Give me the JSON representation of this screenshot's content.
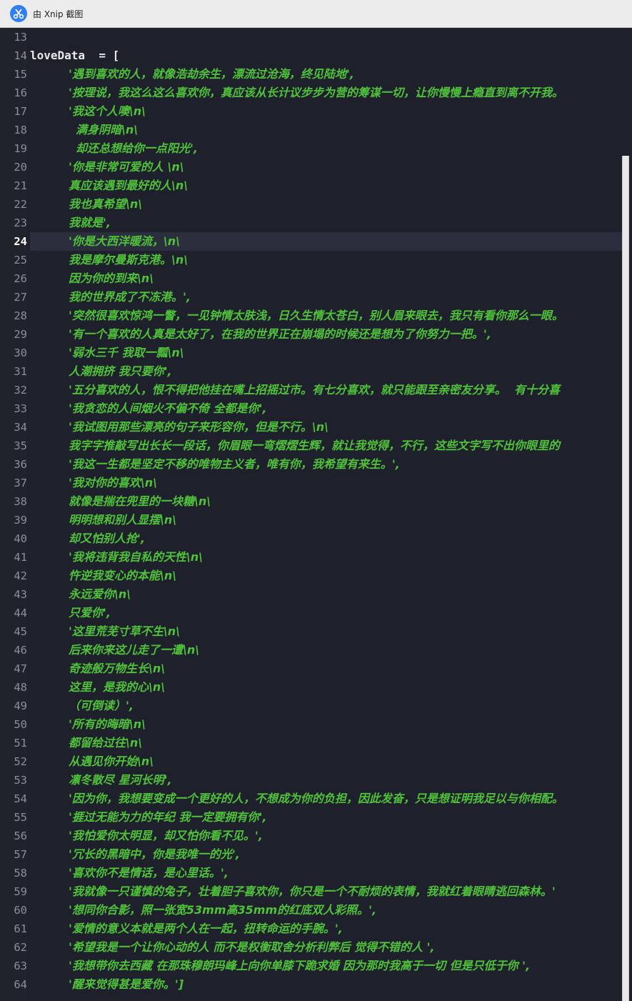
{
  "window": {
    "title": "由 Xnip 截图"
  },
  "editor": {
    "active_line": "24",
    "lines": [
      {
        "n": "13",
        "text": "",
        "indent": 0,
        "plain": true
      },
      {
        "n": "14",
        "text": "loveData  = [",
        "indent": 0,
        "plain": true
      },
      {
        "n": "15",
        "text": "'遇到喜欢的人，就像浩劫余生，漂流过沧海，终见陆地',",
        "indent": 54
      },
      {
        "n": "16",
        "text": "'按理说，我这么这么喜欢你，真应该从长计议步步为营的筹谋一切，让你慢慢上瘾直到离不开我。",
        "indent": 54
      },
      {
        "n": "17",
        "text": "'我这个人噢\\n\\",
        "indent": 54
      },
      {
        "n": "18",
        "text": "满身阴暗\\n\\",
        "indent": 64
      },
      {
        "n": "19",
        "text": "却还总想给你一点阳光',",
        "indent": 64
      },
      {
        "n": "20",
        "text": "'你是非常可爱的人 \\n\\",
        "indent": 54
      },
      {
        "n": "21",
        "text": "真应该遇到最好的人\\n\\",
        "indent": 54
      },
      {
        "n": "22",
        "text": "我也真希望\\n\\",
        "indent": 54
      },
      {
        "n": "23",
        "text": "我就是',",
        "indent": 54
      },
      {
        "n": "24",
        "text": "'你是大西洋暖流，\\n\\",
        "indent": 54
      },
      {
        "n": "25",
        "text": "我是摩尔曼斯克港。\\n\\",
        "indent": 54
      },
      {
        "n": "26",
        "text": "因为你的到来\\n\\",
        "indent": 54
      },
      {
        "n": "27",
        "text": "我的世界成了不冻港。',",
        "indent": 54
      },
      {
        "n": "28",
        "text": "'突然很喜欢惊鸿一瞥，一见钟情太肤浅，日久生情太苍白，别人眉来眼去，我只有看你那么一眼。",
        "indent": 54
      },
      {
        "n": "29",
        "text": "'有一个喜欢的人真是太好了，在我的世界正在崩塌的时候还是想为了你努力一把。',",
        "indent": 54
      },
      {
        "n": "30",
        "text": "'弱水三千 我取一瓢\\n\\",
        "indent": 54
      },
      {
        "n": "31",
        "text": "人潮拥挤 我只要你',",
        "indent": 54
      },
      {
        "n": "32",
        "text": "'五分喜欢的人，恨不得把他挂在嘴上招摇过市。有七分喜欢，就只能跟至亲密友分享。  有十分喜",
        "indent": 54
      },
      {
        "n": "33",
        "text": "'我贪恋的人间烟火不偏不倚 全都是你',",
        "indent": 54
      },
      {
        "n": "34",
        "text": "'我试图用那些漂亮的句子来形容你，但是不行。\\n\\",
        "indent": 54
      },
      {
        "n": "35",
        "text": "我字字推敲写出长长一段话，你眉眼一弯熠熠生辉，就让我觉得，不行，这些文字写不出你眼里的",
        "indent": 54
      },
      {
        "n": "36",
        "text": "'我这一生都是坚定不移的唯物主义者，唯有你，我希望有来生。',",
        "indent": 54
      },
      {
        "n": "37",
        "text": "'我对你的喜欢\\n\\",
        "indent": 54
      },
      {
        "n": "38",
        "text": "就像是揣在兜里的一块糖\\n\\",
        "indent": 54
      },
      {
        "n": "39",
        "text": "明明想和别人显摆\\n\\",
        "indent": 54
      },
      {
        "n": "40",
        "text": "却又怕别人抢',",
        "indent": 54
      },
      {
        "n": "41",
        "text": "'我将违背我自私的天性\\n\\",
        "indent": 54
      },
      {
        "n": "42",
        "text": "忤逆我变心的本能\\n\\",
        "indent": 54
      },
      {
        "n": "43",
        "text": "永远爱你\\n\\",
        "indent": 54
      },
      {
        "n": "44",
        "text": "只爱你',",
        "indent": 54
      },
      {
        "n": "45",
        "text": "'这里荒芜寸草不生\\n\\",
        "indent": 54
      },
      {
        "n": "46",
        "text": "后来你来这儿走了一遭\\n\\",
        "indent": 54
      },
      {
        "n": "47",
        "text": "奇迹般万物生长\\n\\",
        "indent": 54
      },
      {
        "n": "48",
        "text": "这里，是我的心\\n\\",
        "indent": 54
      },
      {
        "n": "49",
        "text": "（可倒读）',",
        "indent": 54
      },
      {
        "n": "50",
        "text": "'所有的晦暗\\n\\",
        "indent": 54
      },
      {
        "n": "51",
        "text": "都留给过往\\n\\",
        "indent": 54
      },
      {
        "n": "52",
        "text": "从遇见你开始\\n\\",
        "indent": 54
      },
      {
        "n": "53",
        "text": "凛冬散尽 星河长明',",
        "indent": 54
      },
      {
        "n": "54",
        "text": "'因为你，我想要变成一个更好的人，不想成为你的负担，因此发奋，只是想证明我足以与你相配。",
        "indent": 54
      },
      {
        "n": "55",
        "text": "'捱过无能为力的年纪 我一定要拥有你',",
        "indent": 54
      },
      {
        "n": "56",
        "text": "'我怕爱你太明显，却又怕你看不见。',",
        "indent": 54
      },
      {
        "n": "57",
        "text": "'冗长的黑暗中，你是我唯一的光',",
        "indent": 54
      },
      {
        "n": "58",
        "text": "'喜欢你不是情话，是心里话。',",
        "indent": 54
      },
      {
        "n": "59",
        "text": "'我就像一只谨慎的兔子，壮着胆子喜欢你，你只是一个不耐烦的表情，我就红着眼睛逃回森林。'",
        "indent": 54
      },
      {
        "n": "60",
        "text": "'想同你合影，照一张宽53mm高35mm的红底双人彩照。',",
        "indent": 54
      },
      {
        "n": "61",
        "text": "'爱情的意义本就是两个人在一起，扭转命运的手腕。',",
        "indent": 54
      },
      {
        "n": "62",
        "text": "'希望我是一个让你心动的人 而不是权衡取舍分析利弊后 觉得不错的人 ',",
        "indent": 54
      },
      {
        "n": "63",
        "text": "'我想带你去西藏 在那珠穆朗玛峰上向你单膝下跪求婚 因为那时我高于一切 但是只低于你 ',",
        "indent": 54
      },
      {
        "n": "64",
        "text": "'醒来觉得甚是爱你。']",
        "indent": 54
      }
    ]
  },
  "colors": {
    "background": "#1e212b",
    "string": "#4fc23a",
    "plain": "#e8e8e8",
    "line_number": "#8b8f99",
    "active_line_bg": "#2b2f3d"
  },
  "icons": {
    "app": "xnip-scissors-icon"
  }
}
